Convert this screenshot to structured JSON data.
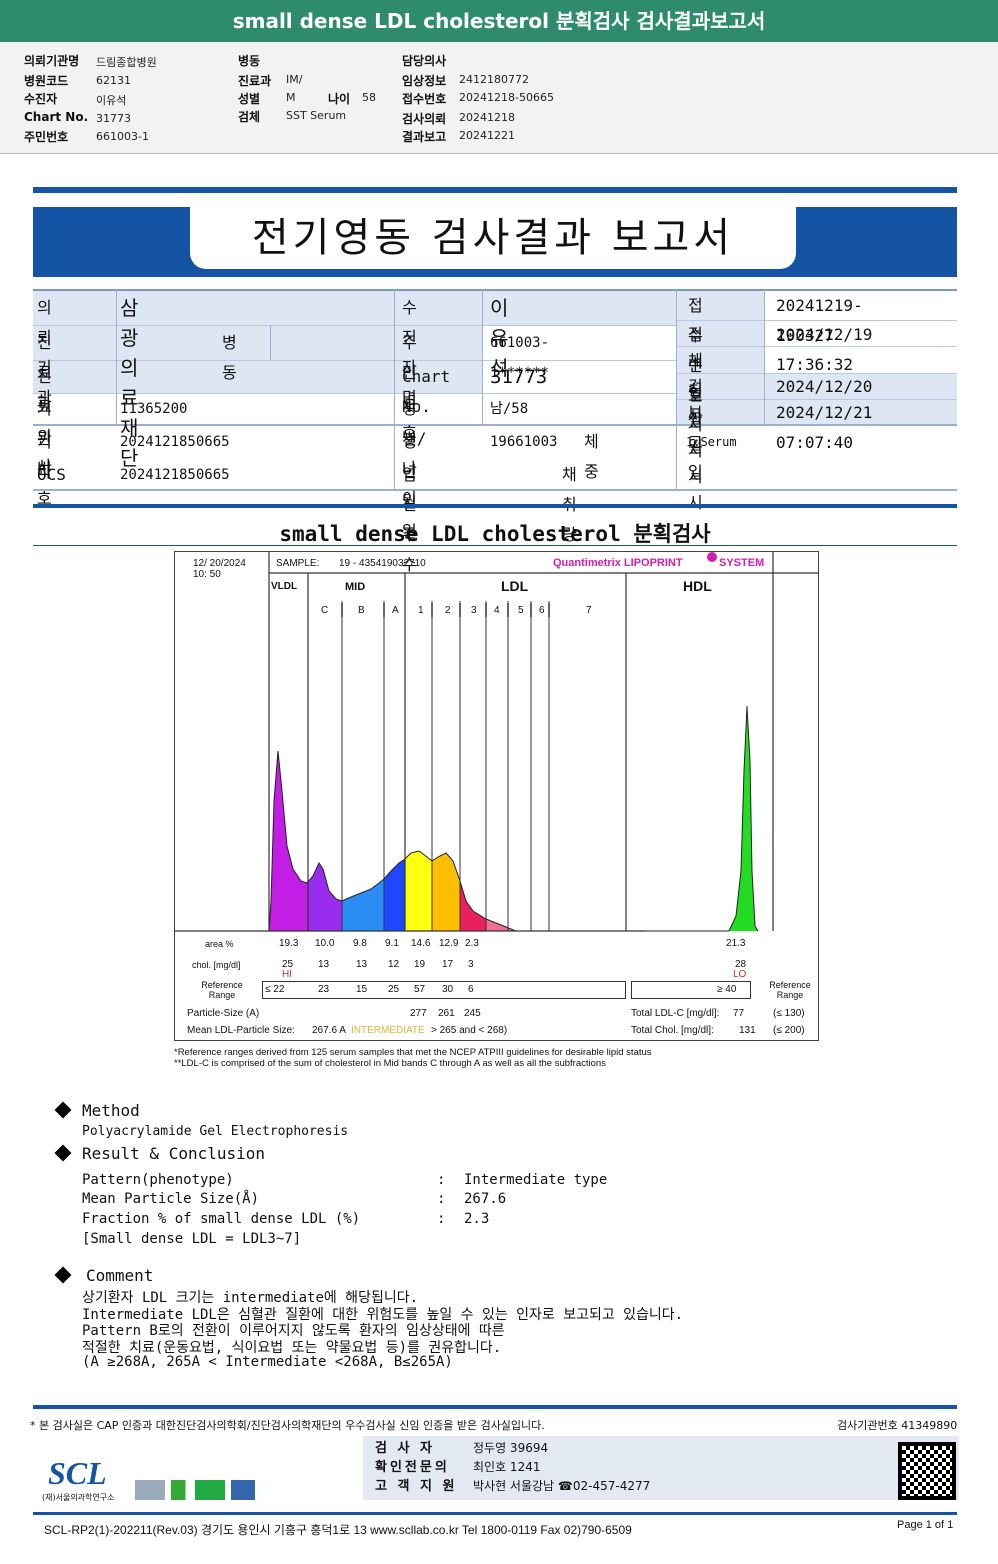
{
  "top": {
    "title": "small dense LDL cholesterol 분획검사 검사결과보고서"
  },
  "info": {
    "col1": [
      [
        "의뢰기관명",
        "드림종합병원"
      ],
      [
        "병원코드",
        "62131"
      ],
      [
        "수진자",
        "이유석"
      ],
      [
        "Chart No.",
        "31773"
      ],
      [
        "주민번호",
        "661003-1"
      ]
    ],
    "col2": [
      [
        "병동",
        ""
      ],
      [
        "진료과",
        "IM/"
      ],
      [
        "성별",
        "M"
      ],
      [
        "검체",
        "SST Serum"
      ]
    ],
    "age_label": "나이",
    "age": "58",
    "col3": [
      [
        "담당의사",
        ""
      ],
      [
        "임상정보",
        "2412180772"
      ],
      [
        "접수번호",
        "20241218-50665"
      ],
      [
        "검사의뢰",
        "20241218"
      ],
      [
        "결과보고",
        "20241221"
      ]
    ]
  },
  "report": {
    "title": "전기영동 검사결과 보고서"
  },
  "patient": {
    "inst_l": "의뢰기관",
    "inst": "삼광의료재단",
    "dept_l": "진 료 과",
    "dept": "병동",
    "doc_l": "진료의사",
    "code_l": "기관번호",
    "code": "11365200",
    "etc_l": "기타",
    "etc": "2024121850665",
    "ocs_l": "OCS",
    "ocs": "2024121850665",
    "name_l": "수진자명",
    "name": "이유석",
    "rrn_l": "주민번호",
    "rrn": "661003-1******",
    "chart_l": "Chart No.",
    "chart": "31773",
    "sex_l": "성별/나이",
    "sex": "남/58",
    "birth_l": "생년월일",
    "birth": "19661003",
    "weight_l": "체중",
    "preg_l": "임신주수",
    "vol_l": "채취량",
    "rcv_no_l": "접수번호",
    "rcv_no": "20241219-190327",
    "rcv_dt_l": "접수일시",
    "rcv_dt": "2024/12/19 17:36:32",
    "col_dt_l": "채취일시",
    "test_dt_l": "검사일시",
    "test_dt": "2024/12/20",
    "rep_dt_l": "보고일시",
    "rep_dt": "2024/12/21 07:07:40",
    "specimen": "1:Serum"
  },
  "section_title": "small dense LDL cholesterol 분획검사",
  "lipoprint": {
    "date": "12/ 20/2024",
    "time": "10: 50",
    "sample_label": "SAMPLE:",
    "sample": "19 - 435419032710",
    "brand": "Quantimetrix LIPOPRINT",
    "brand2": "SYSTEM",
    "groups": [
      "VLDL",
      "MID",
      "LDL",
      "HDL"
    ],
    "bands": [
      "C",
      "B",
      "A",
      "1",
      "2",
      "3",
      "4",
      "5",
      "6",
      "7"
    ],
    "area_label": "area %",
    "area": [
      "19.3",
      "10.0",
      "9.8",
      "9.1",
      "14.6",
      "12.9",
      "2.3"
    ],
    "hdl_area": "21.3",
    "chol_label": "chol. [mg/dl]",
    "chol": [
      "25",
      "13",
      "13",
      "12",
      "19",
      "17",
      "3"
    ],
    "hdl_chol": "28",
    "hi": "HI",
    "lo": "LO",
    "ref_label": "Reference Range",
    "ref": [
      "≤ 22",
      "23",
      "15",
      "25",
      "57",
      "30",
      "6"
    ],
    "hdl_ref": "≥  40",
    "ps_label": "Particle-Size (A)",
    "ps": [
      "277",
      "261",
      "245"
    ],
    "mean_label": "Mean LDL-Particle Size:",
    "mean": "267.6 A",
    "mean_class": "INTERMEDIATE",
    "mean_range": "> 265 and < 268)",
    "tldl_label": "Total LDL-C [mg/dl]:",
    "tldl": "77",
    "tldl_ref": "(≤ 130)",
    "tchol_label": "Total Chol. [mg/dl]:",
    "tchol": "131",
    "tchol_ref": "(≤ 200)",
    "note1": "*Reference ranges derived from 125 serum samples that met the NCEP ATPIII guidelines for desirable lipid status",
    "note2": "**LDL-C is comprised of the sum of cholesterol in Mid bands C through A as well as all the subfractions",
    "colors": {
      "vldl": "#c21ee6",
      "C": "#9a2cf0",
      "B": "#2a8cf5",
      "A": "#1f47ff",
      "1": "#ffff10",
      "2": "#ffbf00",
      "3": "#e8205e",
      "tail": "#f07090",
      "hdl": "#22dd22"
    }
  },
  "method": {
    "title": "Method",
    "text": "Polyacrylamide Gel Electrophoresis"
  },
  "result": {
    "title": "Result & Conclusion",
    "rows": [
      [
        "Pattern(phenotype)",
        "Intermediate type"
      ],
      [
        "Mean Particle Size(Å)",
        "267.6"
      ],
      [
        "Fraction % of small dense LDL (%)",
        "2.3"
      ]
    ],
    "note": "[Small dense LDL = LDL3~7]"
  },
  "comment": {
    "title": "Comment",
    "lines": [
      "상기환자 LDL 크기는 intermediate에 해당됩니다.",
      "Intermediate LDL은 심혈관 질환에 대한 위험도를 높일 수 있는 인자로 보고되고 있습니다.",
      "Pattern B로의 전환이 이루어지지 않도록 환자의 임상상태에 따른",
      "적절한 치료(운동요법, 식이요법 또는 약물요법 등)를 권유합니다.",
      "(A ≥268A, 265A < Intermediate <268A, B≤265A)"
    ]
  },
  "footer": {
    "cert": "* 본 검사실은 CAP 인증과 대한진단검사의학회/진단검사의학재단의 우수검사실 신임 인증을 받은 검사실입니다.",
    "lab_no": "검사기관번호 41349890",
    "sig": [
      [
        "검 사 자",
        "정두영 39694"
      ],
      [
        "확인전문의",
        "최인호 1241"
      ],
      [
        "고 객 지 원",
        "박사현 서울강남 ☎02-457-4277"
      ]
    ],
    "logo": "SCL",
    "logo_sub": "(재)서울의과학연구소",
    "address": "SCL-RP2(1)-202211(Rev.03) 경기도 용인시 기흥구 흥덕1로 13  www.scllab.co.kr  Tel 1800-0119  Fax 02)790-6509",
    "page": "Page 1 of 1"
  }
}
